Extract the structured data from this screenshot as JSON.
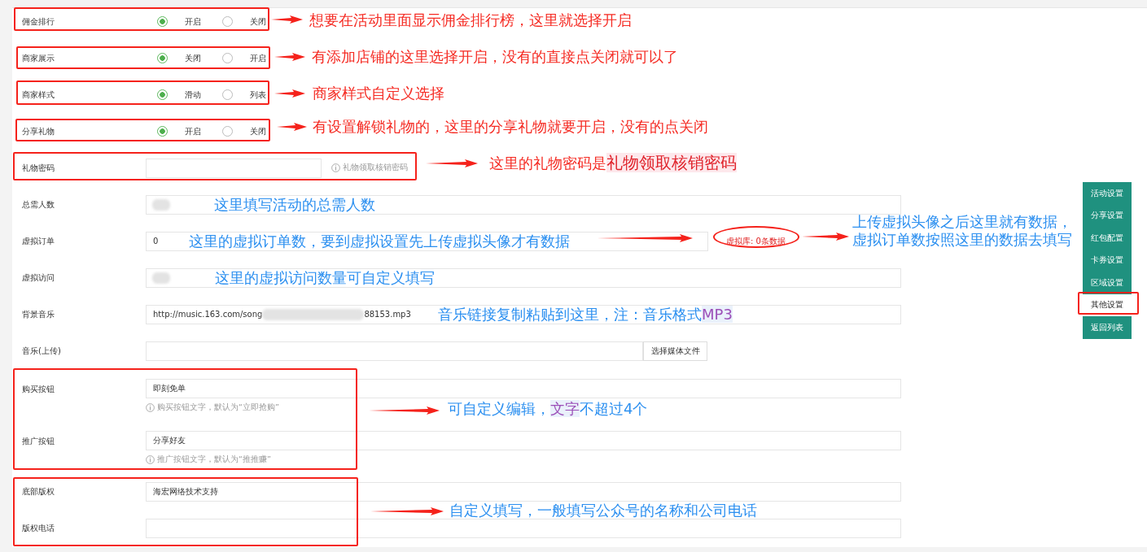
{
  "form": {
    "rows": [
      {
        "kind": "radio",
        "label": "佣金排行",
        "options": [
          {
            "label": "开启",
            "selected": true
          },
          {
            "label": "关闭",
            "selected": false
          }
        ]
      },
      {
        "kind": "radio",
        "label": "商家展示",
        "options": [
          {
            "label": "关闭",
            "selected": true
          },
          {
            "label": "开启",
            "selected": false
          }
        ]
      },
      {
        "kind": "radio",
        "label": "商家样式",
        "options": [
          {
            "label": "滑动",
            "selected": true
          },
          {
            "label": "列表",
            "selected": false
          }
        ]
      },
      {
        "kind": "radio",
        "label": "分享礼物",
        "options": [
          {
            "label": "开启",
            "selected": true
          },
          {
            "label": "关闭",
            "selected": false
          }
        ]
      },
      {
        "kind": "short_input",
        "label": "礼物密码",
        "hint": "礼物领取核销密码"
      },
      {
        "kind": "blurred_input",
        "label": "总需人数"
      },
      {
        "kind": "badge_input",
        "label": "虚拟订单",
        "value": "0",
        "badge": "虚拟库: 0条数据"
      },
      {
        "kind": "blurred_input",
        "label": "虚拟访问"
      },
      {
        "kind": "split_input",
        "label": "背景音乐",
        "value_start": "http://music.163.com/song",
        "value_end": "88153.mp3"
      },
      {
        "kind": "upload_input",
        "label": "音乐(上传)",
        "button": "选择媒体文件"
      },
      {
        "kind": "help_input",
        "label": "购买按钮",
        "value": "即刻免单",
        "help": "购买按钮文字，默认为“立即抢购”"
      },
      {
        "kind": "help_input",
        "label": "推广按钮",
        "value": "分享好友",
        "help": "推广按钮文字，默认为“推推赚”"
      },
      {
        "kind": "input",
        "label": "底部版权",
        "value": "海宏网络技术支持"
      },
      {
        "kind": "input",
        "label": "版权电话"
      }
    ]
  },
  "side_menu": [
    {
      "label": "活动设置",
      "selected": false
    },
    {
      "label": "分享设置",
      "selected": false
    },
    {
      "label": "红包配置",
      "selected": false
    },
    {
      "label": "卡券设置",
      "selected": false
    },
    {
      "label": "区域设置",
      "selected": false
    },
    {
      "label": "其他设置",
      "selected": true
    },
    {
      "label": "返回列表",
      "selected": false
    }
  ],
  "annotations": [
    {
      "kind": "red",
      "parts": [
        {
          "text": "想要在活动里面显示佣金排行榜，这里就选择开启",
          "emphasis": false
        }
      ]
    },
    {
      "kind": "red",
      "parts": [
        {
          "text": "有添加店铺的这里选择开启，没有的直接点关闭就可以了",
          "emphasis": false
        }
      ]
    },
    {
      "kind": "red",
      "parts": [
        {
          "text": "商家样式自定义选择",
          "emphasis": false
        }
      ]
    },
    {
      "kind": "red",
      "parts": [
        {
          "text": "有设置解锁礼物的，这里的分享礼物就要开启，没有的点关闭",
          "emphasis": false
        }
      ]
    },
    {
      "kind": "red",
      "parts": [
        {
          "text": "这里的礼物密码是",
          "emphasis": false
        },
        {
          "text": "礼物领取核销密码",
          "emphasis": true
        }
      ]
    },
    {
      "kind": "blue",
      "parts": [
        {
          "text": "这里填写活动的总需人数",
          "emphasis": false
        }
      ]
    },
    {
      "kind": "blue",
      "parts": [
        {
          "text": "这里的虚拟订单数，要到虚拟设置先上传虚拟头像才有数据",
          "emphasis": false
        }
      ]
    },
    {
      "kind": "blue",
      "parts": [
        {
          "text": "上传虚拟头像之后这里就有数据，虚拟订单数按照这里的数据去填写",
          "emphasis": false
        }
      ]
    },
    {
      "kind": "blue",
      "parts": [
        {
          "text": "这里的虚拟访问数量可自定义填写",
          "emphasis": false
        }
      ]
    },
    {
      "kind": "blue",
      "parts": [
        {
          "text": "音乐链接复制粘贴到这里，注：音乐格式",
          "emphasis": false
        },
        {
          "text": "MP3",
          "emphasis": true
        }
      ]
    },
    {
      "kind": "blue",
      "parts": [
        {
          "text": "可自定义编辑，",
          "emphasis": false
        },
        {
          "text": "文字",
          "emphasis": true
        },
        {
          "text": "不超过4个",
          "emphasis": false
        }
      ]
    },
    {
      "kind": "blue",
      "parts": [
        {
          "text": "自定义填写，一般填写公众号的名称和公司电话",
          "emphasis": false
        }
      ]
    }
  ]
}
